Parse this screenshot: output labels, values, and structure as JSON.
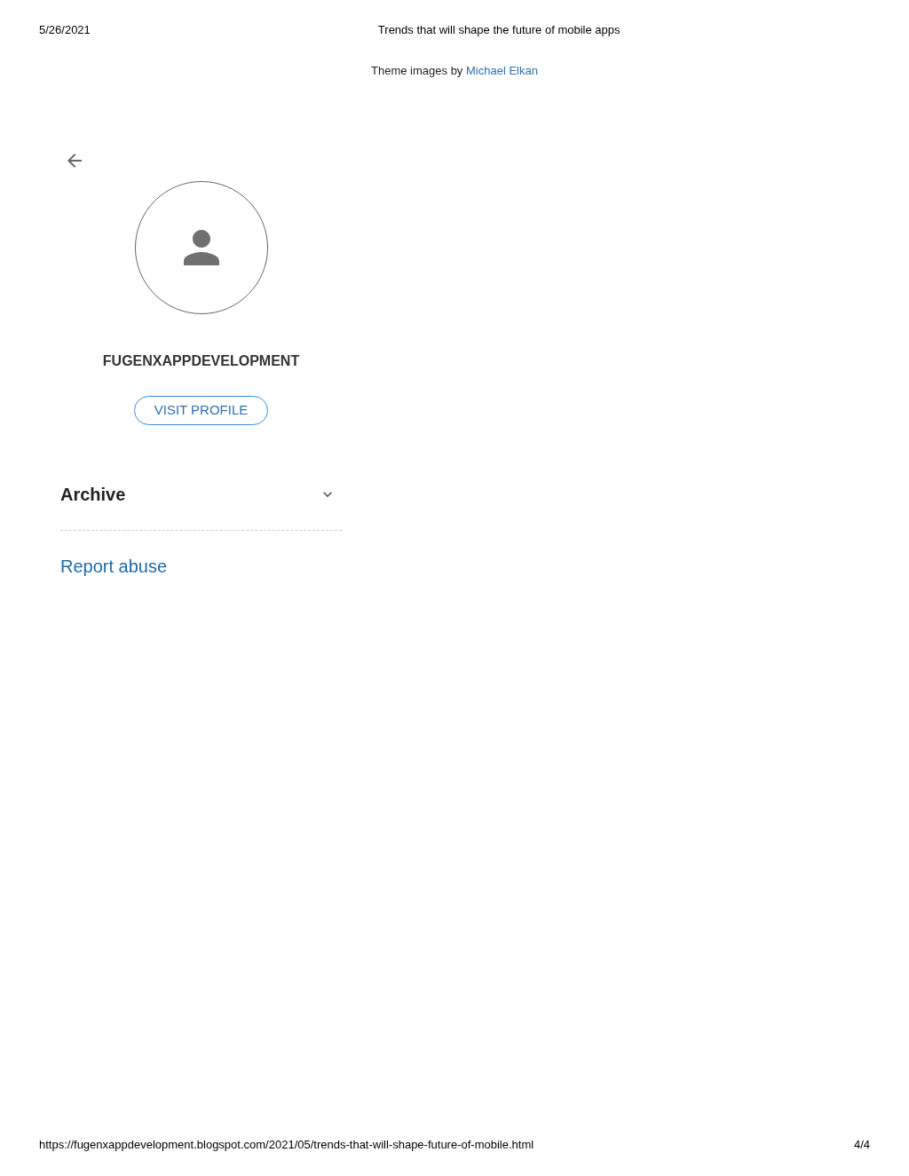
{
  "print_header": {
    "date": "5/26/2021",
    "title": "Trends that will shape the future of mobile apps"
  },
  "credit": {
    "text": "Theme images by",
    "link": "Michael Elkan"
  },
  "profile": {
    "name": "FUGENXAPPDEVELOPMENT",
    "button": "VISIT PROFILE"
  },
  "archive": {
    "label": "Archive",
    "expanded": false
  },
  "report_link": "Report abuse",
  "print_footer": {
    "url": "https://fugenxappdevelopment.blogspot.com/2021/05/trends-that-will-shape-future-of-mobile.html",
    "page": "4/4"
  }
}
